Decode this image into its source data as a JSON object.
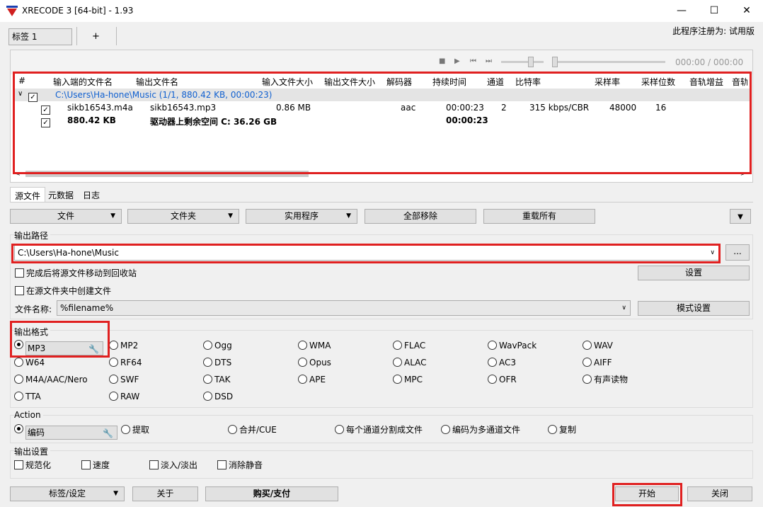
{
  "window": {
    "title": "XRECODE 3 [64-bit] - 1.93",
    "min": "—",
    "max": "☐",
    "close": "✕"
  },
  "tabs": {
    "tab1": "标签 1",
    "add": "+"
  },
  "registration": "此程序注册为: 试用版",
  "player": {
    "time": "000:00 / 000:00",
    "stop": "■",
    "play": "▶",
    "prev": "⏮",
    "next": "⏭"
  },
  "table": {
    "headers": [
      "#",
      "输入端的文件名",
      "输出文件名",
      "输入文件大小",
      "输出文件大小",
      "解码器",
      "持续时间",
      "通道",
      "比特率",
      "采样率",
      "采样位数",
      "音轨增益",
      "音轨"
    ],
    "group": "C:\\Users\\Ha-hone\\Music (1/1, 880.42 KB, 00:00:23)",
    "row": {
      "input": "sikb16543.m4a",
      "output": "sikb16543.mp3",
      "in_size": "0.86 MB",
      "decoder": "aac",
      "duration": "00:00:23",
      "channels": "2",
      "bitrate": "315 kbps/CBR",
      "samplerate": "48000",
      "bits": "16"
    },
    "summary": {
      "size": "880.42 KB",
      "free": "驱动器上剩余空间 C: 36.26 GB",
      "duration": "00:00:23"
    }
  },
  "subtabs": [
    "源文件",
    "元数据",
    "日志"
  ],
  "toolbar": {
    "file": "文件",
    "folder": "文件夹",
    "utility": "实用程序",
    "remove_all": "全部移除",
    "reload": "重载所有"
  },
  "output_path": {
    "label": "输出路径",
    "value": "C:\\Users\\Ha-hone\\Music",
    "browse": "...",
    "move_to_recycle": "完成后将源文件移动到回收站",
    "settings": "设置",
    "create_in_source": "在源文件夹中创建文件",
    "filename_label": "文件名称:",
    "filename": "%filename%",
    "pattern_settings": "模式设置"
  },
  "output_format": {
    "label": "输出格式",
    "selected": "MP3",
    "rows": [
      [
        "MP3",
        "MP2",
        "Ogg",
        "WMA",
        "FLAC",
        "WavPack",
        "WAV"
      ],
      [
        "W64",
        "RF64",
        "DTS",
        "Opus",
        "ALAC",
        "AC3",
        "AIFF"
      ],
      [
        "M4A/AAC/Nero",
        "SWF",
        "TAK",
        "APE",
        "MPC",
        "OFR",
        "有声读物"
      ],
      [
        "TTA",
        "RAW",
        "DSD"
      ]
    ]
  },
  "action": {
    "label": "Action",
    "encode": "编码",
    "extract": "提取",
    "merge": "合并/CUE",
    "split": "每个通道分割成文件",
    "multichannel": "编码为多通道文件",
    "copy": "复制"
  },
  "output_settings": {
    "label": "输出设置",
    "normalize": "规范化",
    "speed": "速度",
    "fade": "淡入/淡出",
    "silence": "消除静音"
  },
  "bottom": {
    "tags": "标签/设定",
    "about": "关于",
    "buy": "购买/支付",
    "start": "开始",
    "close": "关闭"
  },
  "colors": {
    "highlight": "#e02020",
    "group_text": "#1060d0"
  }
}
